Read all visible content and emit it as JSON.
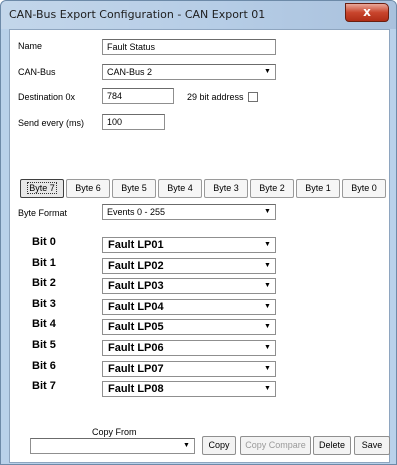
{
  "window": {
    "title": "CAN-Bus Export Configuration - CAN Export 01",
    "close_glyph": "x"
  },
  "form": {
    "name_label": "Name",
    "name_value": "Fault Status",
    "canbus_label": "CAN-Bus",
    "canbus_value": "CAN-Bus 2",
    "destination_label": "Destination 0x",
    "destination_value": "784",
    "bit29_label": "29 bit address",
    "bit29_checked": false,
    "send_label": "Send every (ms)",
    "send_value": "100"
  },
  "byte_tabs": [
    {
      "label": "Byte 7",
      "active": true
    },
    {
      "label": "Byte 6",
      "active": false
    },
    {
      "label": "Byte 5",
      "active": false
    },
    {
      "label": "Byte 4",
      "active": false
    },
    {
      "label": "Byte 3",
      "active": false
    },
    {
      "label": "Byte 2",
      "active": false
    },
    {
      "label": "Byte 1",
      "active": false
    },
    {
      "label": "Byte 0",
      "active": false
    }
  ],
  "byte_format": {
    "label": "Byte Format",
    "value": "Events 0 - 255"
  },
  "bits": [
    {
      "label": "Bit 0",
      "value": "Fault LP01"
    },
    {
      "label": "Bit 1",
      "value": "Fault LP02"
    },
    {
      "label": "Bit 2",
      "value": "Fault LP03"
    },
    {
      "label": "Bit 3",
      "value": "Fault LP04"
    },
    {
      "label": "Bit 4",
      "value": "Fault LP05"
    },
    {
      "label": "Bit 5",
      "value": "Fault LP06"
    },
    {
      "label": "Bit 6",
      "value": "Fault LP07"
    },
    {
      "label": "Bit 7",
      "value": "Fault LP08"
    }
  ],
  "footer": {
    "copy_from_label": "Copy From",
    "copy_from_value": "",
    "copy_label": "Copy",
    "copy_compare_label": "Copy Compare",
    "delete_label": "Delete",
    "save_label": "Save"
  },
  "icons": {
    "dropdown": "chevron-down-icon"
  }
}
